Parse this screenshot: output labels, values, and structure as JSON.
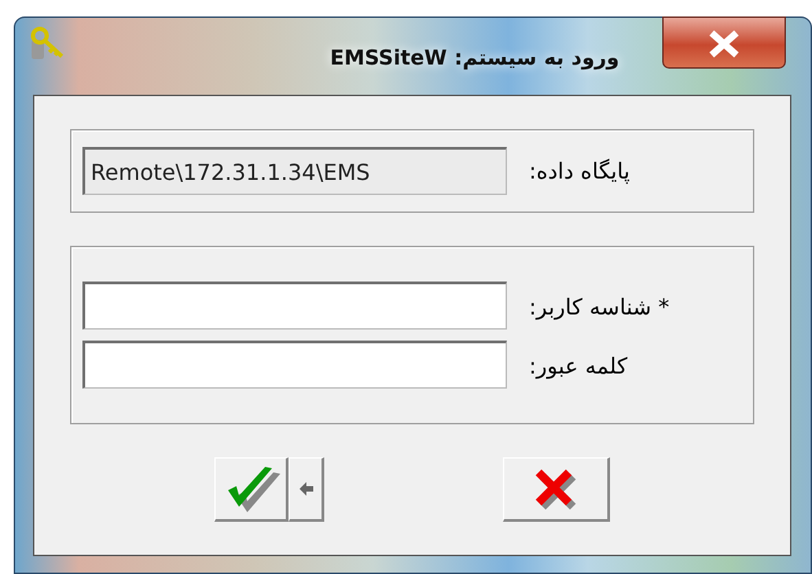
{
  "window": {
    "title": "ورود به سیستم: EMSSiteW"
  },
  "connection": {
    "label": "پایگاه داده:",
    "value": "Remote\\172.31.1.34\\EMS"
  },
  "login": [
    {
      "label": "* شناسه کاربر:"
    },
    {
      "label": "کلمه عبور:"
    }
  ],
  "buttons": [
    {
      "kind": "ok"
    },
    {
      "kind": "menu"
    },
    {
      "kind": "cancel"
    }
  ]
}
